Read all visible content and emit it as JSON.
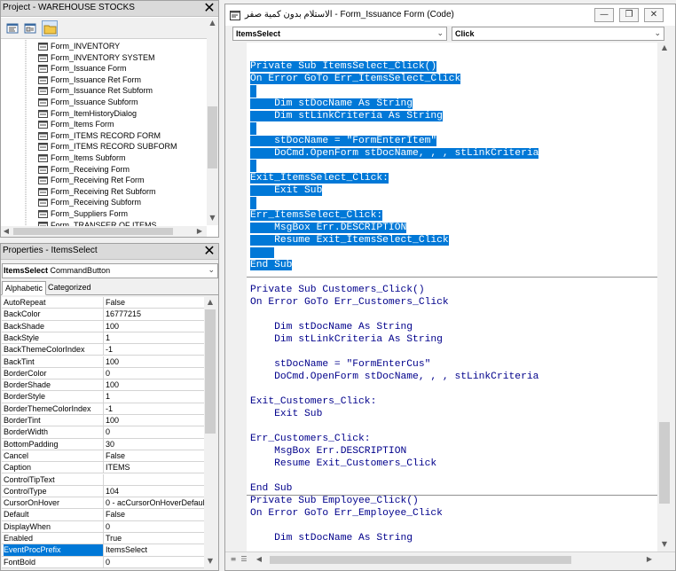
{
  "project_pane": {
    "title": "Project - WAREHOUSE STOCKS",
    "close": "✕",
    "items": [
      "Form_INVENTORY",
      "Form_INVENTORY SYSTEM",
      "Form_Issuance Form",
      "Form_Issuance Ret Form",
      "Form_Issuance Ret Subform",
      "Form_Issuance Subform",
      "Form_ItemHistoryDialog",
      "Form_Items Form",
      "Form_ITEMS RECORD FORM",
      "Form_ITEMS RECORD SUBFORM",
      "Form_Items Subform",
      "Form_Receiving Form",
      "Form_Receiving Ret Form",
      "Form_Receiving Ret Subform",
      "Form_Receiving Subform",
      "Form_Suppliers Form",
      "Form_TRANSFER OF ITEMS"
    ]
  },
  "properties_pane": {
    "title": "Properties - ItemsSelect",
    "close": "✕",
    "object_name": "ItemsSelect",
    "object_type": "CommandButton",
    "tabs": [
      "Alphabetic",
      "Categorized"
    ],
    "active_tab": "Alphabetic",
    "selected_property": "EventProcPrefix",
    "rows": [
      {
        "name": "AutoRepeat",
        "value": "False"
      },
      {
        "name": "BackColor",
        "value": "16777215"
      },
      {
        "name": "BackShade",
        "value": "100"
      },
      {
        "name": "BackStyle",
        "value": "1"
      },
      {
        "name": "BackThemeColorIndex",
        "value": "-1"
      },
      {
        "name": "BackTint",
        "value": "100"
      },
      {
        "name": "BorderColor",
        "value": "0"
      },
      {
        "name": "BorderShade",
        "value": "100"
      },
      {
        "name": "BorderStyle",
        "value": "1"
      },
      {
        "name": "BorderThemeColorIndex",
        "value": "-1"
      },
      {
        "name": "BorderTint",
        "value": "100"
      },
      {
        "name": "BorderWidth",
        "value": "0"
      },
      {
        "name": "BottomPadding",
        "value": "30"
      },
      {
        "name": "Cancel",
        "value": "False"
      },
      {
        "name": "Caption",
        "value": "ITEMS"
      },
      {
        "name": "ControlTipText",
        "value": ""
      },
      {
        "name": "ControlType",
        "value": "104"
      },
      {
        "name": "CursorOnHover",
        "value": "0 - acCursorOnHoverDefault"
      },
      {
        "name": "Default",
        "value": "False"
      },
      {
        "name": "DisplayWhen",
        "value": "0"
      },
      {
        "name": "Enabled",
        "value": "True"
      },
      {
        "name": "EventProcPrefix",
        "value": "ItemsSelect"
      },
      {
        "name": "FontBold",
        "value": "0"
      }
    ]
  },
  "code_window": {
    "title": "الاستلام بدون كمية صفر - Form_Issuance Form (Code)",
    "object_dropdown": "ItemsSelect",
    "procedure_dropdown": "Click",
    "buttons": {
      "minimize": "—",
      "restore": "❐",
      "close": "✕"
    },
    "lines": [
      {
        "text": "Private Sub ItemsSelect_Click()",
        "hl": true
      },
      {
        "text": "On Error GoTo Err_ItemsSelect_Click",
        "hl": true
      },
      {
        "text": "",
        "hl": true
      },
      {
        "text": "    Dim stDocName As String",
        "hl": true
      },
      {
        "text": "    Dim stLinkCriteria As String",
        "hl": true
      },
      {
        "text": "",
        "hl": true
      },
      {
        "text": "    stDocName = \"FormEnterItem\"",
        "hl": true
      },
      {
        "text": "    DoCmd.OpenForm stDocName, , , stLinkCriteria",
        "hl": true
      },
      {
        "text": "",
        "hl": true
      },
      {
        "text": "Exit_ItemsSelect_Click:",
        "hl": true
      },
      {
        "text": "    Exit Sub",
        "hl": true
      },
      {
        "text": "",
        "hl": true
      },
      {
        "text": "Err_ItemsSelect_Click:",
        "hl": true
      },
      {
        "text": "    MsgBox Err.DESCRIPTION",
        "hl": true
      },
      {
        "text": "    Resume Exit_ItemsSelect_Click",
        "hl": true
      },
      {
        "text": "    ",
        "hl": true
      },
      {
        "text": "End Sub",
        "hl": true
      },
      {
        "text": "Private Sub Customers_Click()",
        "hl": false
      },
      {
        "text": "On Error GoTo Err_Customers_Click",
        "hl": false
      },
      {
        "text": "",
        "hl": false
      },
      {
        "text": "    Dim stDocName As String",
        "hl": false
      },
      {
        "text": "    Dim stLinkCriteria As String",
        "hl": false
      },
      {
        "text": "",
        "hl": false
      },
      {
        "text": "    stDocName = \"FormEnterCus\"",
        "hl": false
      },
      {
        "text": "    DoCmd.OpenForm stDocName, , , stLinkCriteria",
        "hl": false
      },
      {
        "text": "",
        "hl": false
      },
      {
        "text": "Exit_Customers_Click:",
        "hl": false
      },
      {
        "text": "    Exit Sub",
        "hl": false
      },
      {
        "text": "",
        "hl": false
      },
      {
        "text": "Err_Customers_Click:",
        "hl": false
      },
      {
        "text": "    MsgBox Err.DESCRIPTION",
        "hl": false
      },
      {
        "text": "    Resume Exit_Customers_Click",
        "hl": false
      },
      {
        "text": "",
        "hl": false
      },
      {
        "text": "End Sub",
        "hl": false
      },
      {
        "text": "Private Sub Employee_Click()",
        "hl": false
      },
      {
        "text": "On Error GoTo Err_Employee_Click",
        "hl": false
      },
      {
        "text": "",
        "hl": false
      },
      {
        "text": "    Dim stDocName As String",
        "hl": false
      }
    ]
  },
  "colors": {
    "selection": "#0078d7",
    "keyword": "#00008b"
  }
}
